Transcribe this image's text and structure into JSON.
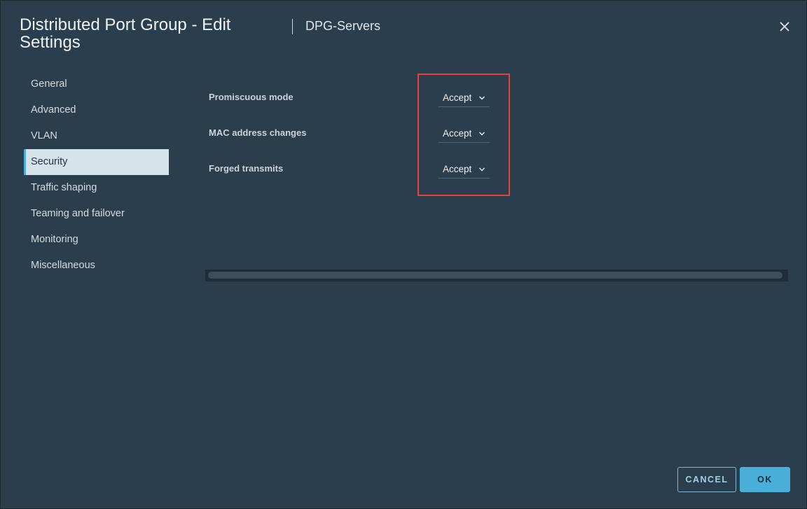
{
  "dialog": {
    "title": "Distributed Port Group - Edit Settings",
    "subtitle": "DPG-Servers",
    "close_icon": "close-icon"
  },
  "nav": {
    "items": [
      {
        "label": "General"
      },
      {
        "label": "Advanced"
      },
      {
        "label": "VLAN"
      },
      {
        "label": "Security",
        "active": true
      },
      {
        "label": "Traffic shaping"
      },
      {
        "label": "Teaming and failover"
      },
      {
        "label": "Monitoring"
      },
      {
        "label": "Miscellaneous"
      }
    ]
  },
  "security": {
    "rows": [
      {
        "label": "Promiscuous mode",
        "value": "Accept"
      },
      {
        "label": "MAC address changes",
        "value": "Accept"
      },
      {
        "label": "Forged transmits",
        "value": "Accept"
      }
    ]
  },
  "footer": {
    "cancel_label": "CANCEL",
    "ok_label": "OK"
  },
  "colors": {
    "background": "#2a3e4d",
    "accent": "#49afd9",
    "highlight": "#e8413c",
    "active_nav": "#d7e3ea"
  }
}
